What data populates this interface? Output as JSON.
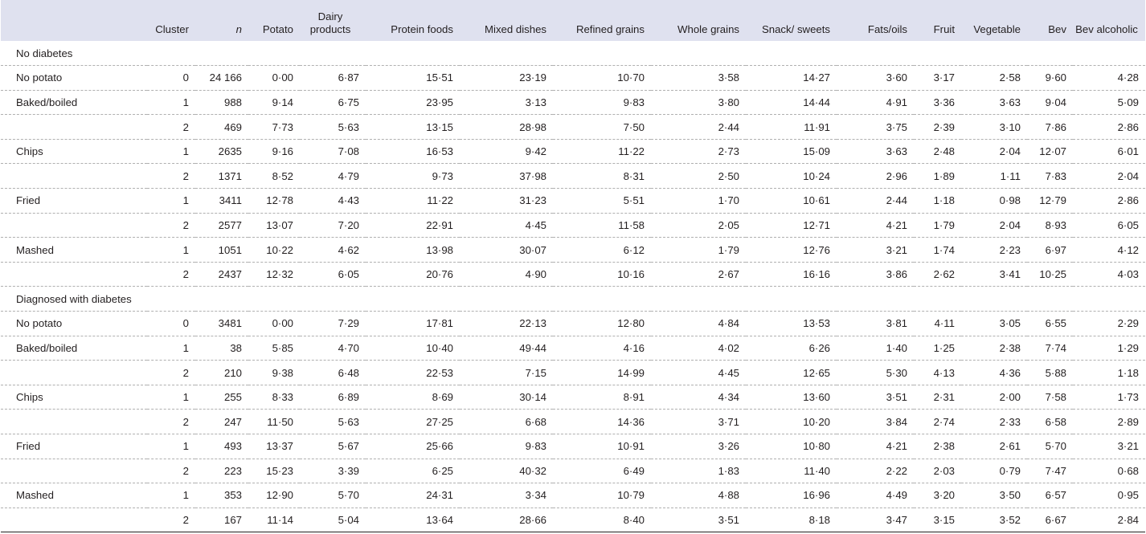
{
  "table": {
    "columns": [
      "",
      "Cluster",
      "n",
      "Potato",
      "Dairy products",
      "Protein foods",
      "Mixed dishes",
      "Refined grains",
      "Whole grains",
      "Snack/ sweets",
      "Fats/oils",
      "Fruit",
      "Vegetable",
      "Bev",
      "Bev alcoholic"
    ],
    "sections": [
      {
        "title": "No diabetes",
        "rows": [
          [
            "No potato",
            "0",
            "24 166",
            "0·00",
            "6·87",
            "15·51",
            "23·19",
            "10·70",
            "3·58",
            "14·27",
            "3·60",
            "3·17",
            "2·58",
            "9·60",
            "4·28"
          ],
          [
            "Baked/boiled",
            "1",
            "988",
            "9·14",
            "6·75",
            "23·95",
            "3·13",
            "9·83",
            "3·80",
            "14·44",
            "4·91",
            "3·36",
            "3·63",
            "9·04",
            "5·09"
          ],
          [
            "",
            "2",
            "469",
            "7·73",
            "5·63",
            "13·15",
            "28·98",
            "7·50",
            "2·44",
            "11·91",
            "3·75",
            "2·39",
            "3·10",
            "7·86",
            "2·86"
          ],
          [
            "Chips",
            "1",
            "2635",
            "9·16",
            "7·08",
            "16·53",
            "9·42",
            "11·22",
            "2·73",
            "15·09",
            "3·63",
            "2·48",
            "2·04",
            "12·07",
            "6·01"
          ],
          [
            "",
            "2",
            "1371",
            "8·52",
            "4·79",
            "9·73",
            "37·98",
            "8·31",
            "2·50",
            "10·24",
            "2·96",
            "1·89",
            "1·11",
            "7·83",
            "2·04"
          ],
          [
            "Fried",
            "1",
            "3411",
            "12·78",
            "4·43",
            "11·22",
            "31·23",
            "5·51",
            "1·70",
            "10·61",
            "2·44",
            "1·18",
            "0·98",
            "12·79",
            "2·86"
          ],
          [
            "",
            "2",
            "2577",
            "13·07",
            "7·20",
            "22·91",
            "4·45",
            "11·58",
            "2·05",
            "12·71",
            "4·21",
            "1·79",
            "2·04",
            "8·93",
            "6·05"
          ],
          [
            "Mashed",
            "1",
            "1051",
            "10·22",
            "4·62",
            "13·98",
            "30·07",
            "6·12",
            "1·79",
            "12·76",
            "3·21",
            "1·74",
            "2·23",
            "6·97",
            "4·12"
          ],
          [
            "",
            "2",
            "2437",
            "12·32",
            "6·05",
            "20·76",
            "4·90",
            "10·16",
            "2·67",
            "16·16",
            "3·86",
            "2·62",
            "3·41",
            "10·25",
            "4·03"
          ]
        ]
      },
      {
        "title": "Diagnosed with diabetes",
        "rows": [
          [
            "No potato",
            "0",
            "3481",
            "0·00",
            "7·29",
            "17·81",
            "22·13",
            "12·80",
            "4·84",
            "13·53",
            "3·81",
            "4·11",
            "3·05",
            "6·55",
            "2·29"
          ],
          [
            "Baked/boiled",
            "1",
            "38",
            "5·85",
            "4·70",
            "10·40",
            "49·44",
            "4·16",
            "4·02",
            "6·26",
            "1·40",
            "1·25",
            "2·38",
            "7·74",
            "1·29"
          ],
          [
            "",
            "2",
            "210",
            "9·38",
            "6·48",
            "22·53",
            "7·15",
            "14·99",
            "4·45",
            "12·65",
            "5·30",
            "4·13",
            "4·36",
            "5·88",
            "1·18"
          ],
          [
            "Chips",
            "1",
            "255",
            "8·33",
            "6·89",
            "8·69",
            "30·14",
            "8·91",
            "4·34",
            "13·60",
            "3·51",
            "2·31",
            "2·00",
            "7·58",
            "1·73"
          ],
          [
            "",
            "2",
            "247",
            "11·50",
            "5·63",
            "27·25",
            "6·68",
            "14·36",
            "3·71",
            "10·20",
            "3·84",
            "2·74",
            "2·33",
            "6·58",
            "2·89"
          ],
          [
            "Fried",
            "1",
            "493",
            "13·37",
            "5·67",
            "25·66",
            "9·83",
            "10·91",
            "3·26",
            "10·80",
            "4·21",
            "2·38",
            "2·61",
            "5·70",
            "3·21"
          ],
          [
            "",
            "2",
            "223",
            "15·23",
            "3·39",
            "6·25",
            "40·32",
            "6·49",
            "1·83",
            "11·40",
            "2·22",
            "2·03",
            "0·79",
            "7·47",
            "0·68"
          ],
          [
            "Mashed",
            "1",
            "353",
            "12·90",
            "5·70",
            "24·31",
            "3·34",
            "10·79",
            "4·88",
            "16·96",
            "4·49",
            "3·20",
            "3·50",
            "6·57",
            "0·95"
          ],
          [
            "",
            "2",
            "167",
            "11·14",
            "5·04",
            "13·64",
            "28·66",
            "8·40",
            "3·51",
            "8·18",
            "3·47",
            "3·15",
            "3·52",
            "6·67",
            "2·84"
          ]
        ]
      }
    ]
  },
  "colors": {
    "header_background": "#dfe1ef",
    "text": "#231f20",
    "row_divider": "#b0b0b0"
  }
}
